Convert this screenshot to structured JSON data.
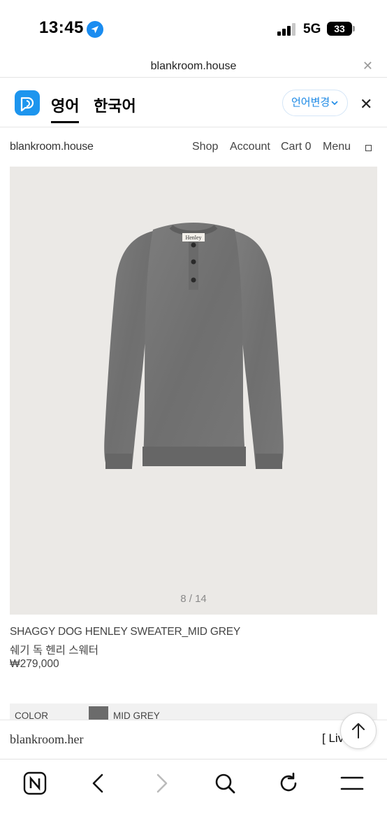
{
  "status_bar": {
    "time": "13:45",
    "network": "5G",
    "battery": "33",
    "icons": [
      "location-arrow-icon",
      "signal-bars-icon",
      "battery-icon"
    ]
  },
  "browser": {
    "url": "blankroom.house",
    "close_icon": "close-icon"
  },
  "translate_bar": {
    "app_icon": "papago-icon",
    "tab_english": "영어",
    "tab_korean": "한국어",
    "change_language_label": "언어변경",
    "accent_color": "#1d95ee"
  },
  "site": {
    "logo": "blankroom.house",
    "nav": {
      "shop": "Shop",
      "account": "Account",
      "cart": "Cart 0",
      "menu": "Menu"
    }
  },
  "product": {
    "image_counter": "8 / 14",
    "name": "SHAGGY DOG HENLEY SWEATER_MID GREY",
    "name_ko": "쉐기 독 헨리 스웨터",
    "price": "₩279,000",
    "garment_label": "Henley",
    "color_label": "COLOR",
    "color_value": "MID GREY",
    "color_swatch": "#6b6b6b"
  },
  "footer": {
    "text": "blankroom.her",
    "live": "[ Live ]"
  },
  "toolbar": {
    "icons": [
      "naver-home-icon",
      "back-icon",
      "forward-icon",
      "search-icon",
      "reload-icon",
      "menu-icon"
    ]
  }
}
